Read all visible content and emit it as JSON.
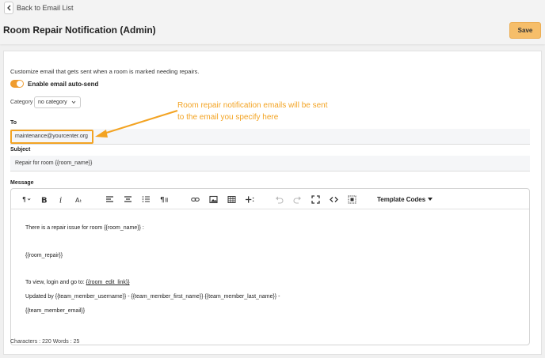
{
  "header": {
    "back_label": "Back to Email List",
    "title": "Room Repair Notification (Admin)",
    "save_label": "Save"
  },
  "form": {
    "description": "Customize email that gets sent when a room is marked needing repairs.",
    "auto_send_label": "Enable email auto-send",
    "auto_send_enabled": true,
    "category_label": "Category",
    "category_value": "no category",
    "to_label": "To",
    "to_value": "maintenance@yourcenter.org",
    "subject_label": "Subject",
    "subject_value": "Repair for room {{room_name}}",
    "message_label": "Message"
  },
  "annotation": {
    "line1": "Room repair notification emails will be sent",
    "line2": "to the email you specify here",
    "color": "#f3a322"
  },
  "editor": {
    "toolbar": {
      "template_codes_label": "Template Codes"
    },
    "body": {
      "line1": "There is a repair issue for room {{room_name}} :",
      "line2": "{{room_repair}}",
      "line3_prefix": "To view, login and go to: ",
      "line3_link": "{{room_edit_link}}",
      "line4": "Updated by {{team_member_username}} - {{team_member_first_name}} {{team_member_last_name}} -",
      "line5": "{{team_member_email}}"
    },
    "counter": "Characters : 220 Words : 25"
  }
}
